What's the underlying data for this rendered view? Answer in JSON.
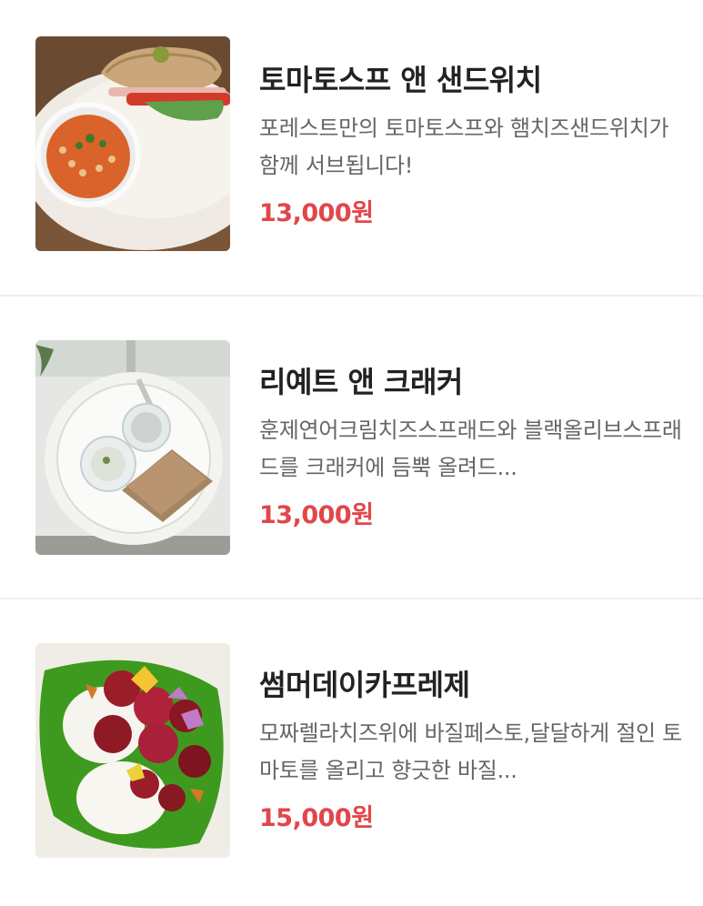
{
  "menu": {
    "items": [
      {
        "name": "토마토스프 앤 샌드위치",
        "description": "포레스트만의 토마토스프와 햄치즈샌드위치가 함께 서브됩니다!",
        "price": "13,000원",
        "image_icon": "tomato-soup-sandwich-photo"
      },
      {
        "name": "리예트 앤 크래커",
        "description": "훈제연어크림치즈스프래드와 블랙올리브스프래드를 크래커에 듬뿍 올려드...",
        "price": "13,000원",
        "image_icon": "rillettes-crackers-photo"
      },
      {
        "name": "썸머데이카프레제",
        "description": "모짜렐라치즈위에 바질페스토,달달하게 절인 토마토를 올리고 향긋한 바질...",
        "price": "15,000원",
        "image_icon": "summer-caprese-photo"
      }
    ]
  },
  "colors": {
    "price": "#e2464a",
    "name": "#222222",
    "description": "#666666",
    "divider": "#eeeef0"
  }
}
